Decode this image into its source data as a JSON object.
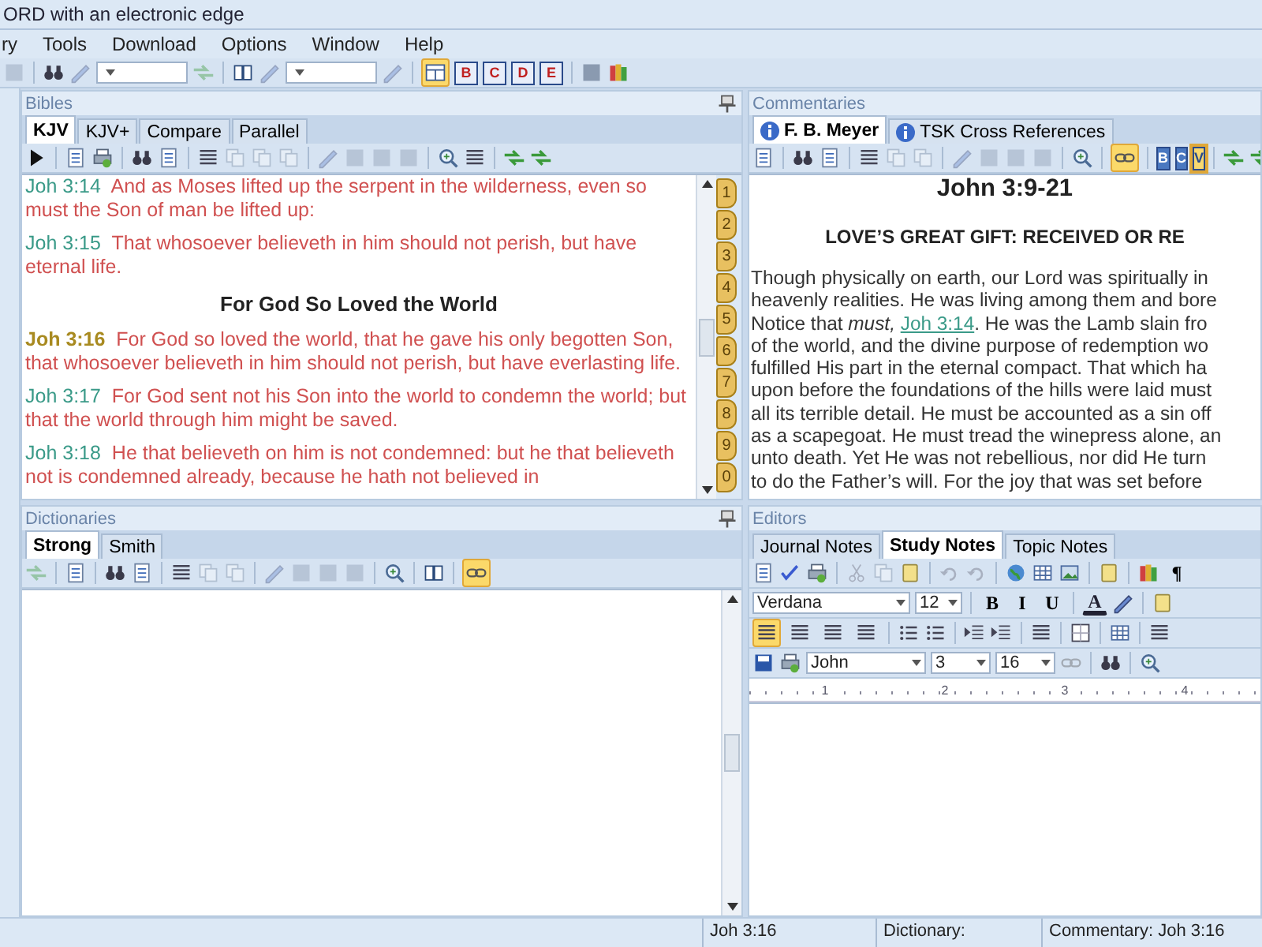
{
  "window": {
    "title": "ORD with an electronic edge"
  },
  "menu": [
    "ry",
    "Tools",
    "Download",
    "Options",
    "Window",
    "Help"
  ],
  "main_toolbar": {
    "layout_selected": true,
    "letters": [
      "B",
      "C",
      "D",
      "E"
    ]
  },
  "bibles": {
    "title": "Bibles",
    "tabs": [
      {
        "label": "KJV",
        "selected": true
      },
      {
        "label": "KJV+",
        "selected": false
      },
      {
        "label": "Compare",
        "selected": false
      },
      {
        "label": "Parallel",
        "selected": false
      }
    ],
    "passage": [
      {
        "kind": "verse",
        "ref": "Joh 3:14",
        "text": "And as Moses lifted up the serpent in the wilderness, even so must the Son of man be lifted up:",
        "current": false
      },
      {
        "kind": "verse",
        "ref": "Joh 3:15",
        "text": "That whosoever believeth in him should not perish, but have eternal life.",
        "current": false
      },
      {
        "kind": "heading",
        "text": "For God So Loved the World"
      },
      {
        "kind": "verse",
        "ref": "Joh 3:16",
        "text": "For God so loved the world, that he gave his only begotten Son, that whosoever believeth in him should not perish, but have everlasting life.",
        "current": true
      },
      {
        "kind": "verse",
        "ref": "Joh 3:17",
        "text": "For God sent not his Son into the world to condemn the world; but that the world through him might be saved.",
        "current": false
      },
      {
        "kind": "verse",
        "ref": "Joh 3:18",
        "text": "He that believeth on him is not condemned: but he that believeth not is condemned already, because he hath not believed in",
        "current": false
      }
    ],
    "bookmarks": [
      "1",
      "2",
      "3",
      "4",
      "5",
      "6",
      "7",
      "8",
      "9",
      "0"
    ]
  },
  "commentaries": {
    "title": "Commentaries",
    "tabs": [
      {
        "label": "F. B. Meyer",
        "selected": true
      },
      {
        "label": "TSK Cross References",
        "selected": false
      }
    ],
    "toolbar": {
      "link_selected": true,
      "letters": [
        {
          "label": "B",
          "selected": false
        },
        {
          "label": "C",
          "selected": false
        },
        {
          "label": "V",
          "selected": true
        }
      ]
    },
    "heading": "John 3:9-21",
    "subheading": "LOVE’S GREAT GIFT: RECEIVED OR RE",
    "lines": [
      {
        "text": "Though physically on earth, our Lord was spiritually in"
      },
      {
        "text": "heavenly realities. He was living among them and bore"
      },
      {
        "text": "Notice that *must,* ",
        "link": "Joh 3:14",
        "after": ". He was the Lamb slain fro"
      },
      {
        "text": "of the world, and the divine purpose of redemption wo"
      },
      {
        "text": "fulfilled His part in the eternal compact. That which ha"
      },
      {
        "text": "upon before the foundations of the hills were laid must"
      },
      {
        "text": "all its terrible detail. He must be accounted as a sin off"
      },
      {
        "text": "as a scapegoat. He must tread the winepress alone, an"
      },
      {
        "text": "unto death. Yet He was not rebellious, nor did He turn"
      },
      {
        "text": "to do the Father’s will. For the joy that was set before"
      }
    ]
  },
  "dictionaries": {
    "title": "Dictionaries",
    "tabs": [
      {
        "label": "Strong",
        "selected": true
      },
      {
        "label": "Smith",
        "selected": false
      }
    ],
    "link_selected": true
  },
  "editors": {
    "title": "Editors",
    "tabs": [
      {
        "label": "Journal Notes",
        "selected": false
      },
      {
        "label": "Study Notes",
        "selected": true
      },
      {
        "label": "Topic Notes",
        "selected": false
      }
    ],
    "pilcrow": "¶",
    "font": "Verdana",
    "size": "12",
    "format_buttons": [
      "B",
      "I",
      "U"
    ],
    "font_color": "A",
    "align_buttons": [
      {
        "selected": true
      },
      {
        "selected": false
      },
      {
        "selected": false
      },
      {
        "selected": false
      }
    ],
    "book": "John",
    "chapter": "3",
    "verse": "16",
    "ruler": [
      "1",
      "2",
      "3",
      "4"
    ]
  },
  "status_bar": [
    "Joh 3:16",
    "Dictionary:",
    "Commentary: Joh 3:16"
  ]
}
